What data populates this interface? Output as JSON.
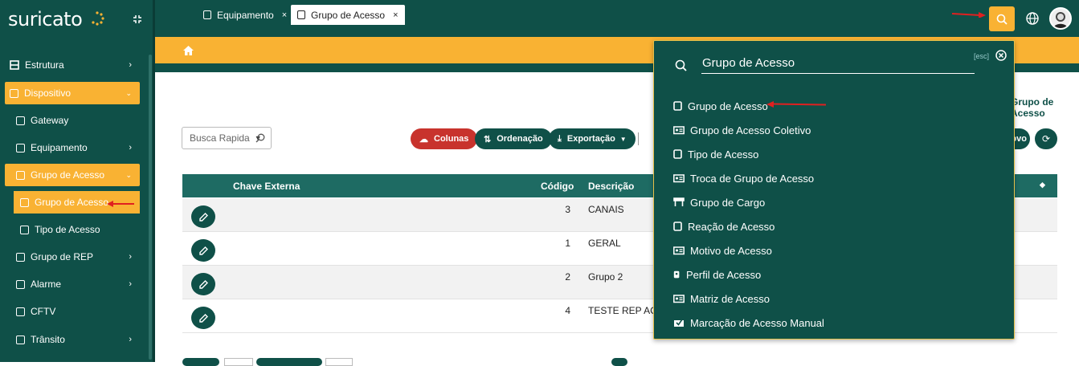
{
  "brand": {
    "logo_text": "suricato"
  },
  "sidebar": {
    "items": [
      {
        "label": "Estrutura"
      },
      {
        "label": "Dispositivo"
      },
      {
        "label": "Gateway"
      },
      {
        "label": "Equipamento"
      },
      {
        "label": "Grupo de Acesso"
      },
      {
        "label": "Grupo de Acesso"
      },
      {
        "label": "Tipo de Acesso"
      },
      {
        "label": "Grupo de REP"
      },
      {
        "label": "Alarme"
      },
      {
        "label": "CFTV"
      },
      {
        "label": "Trânsito"
      }
    ]
  },
  "tabs": [
    {
      "label": "Equipamento",
      "close": "×"
    },
    {
      "label": "Grupo de Acesso",
      "close": "×"
    }
  ],
  "breadcrumb": {
    "current": "Grupo de Acesso"
  },
  "toolbar": {
    "quick_search": "Busca Rapida",
    "colunas": "Colunas",
    "ordenacao": "Ordenação",
    "exportacao": "Exportação",
    "novo": "ovo"
  },
  "table": {
    "columns": [
      "Chave Externa",
      "Código",
      "Descrição"
    ],
    "rows": [
      {
        "codigo": "3",
        "descricao": "CANAIS"
      },
      {
        "codigo": "1",
        "descricao": "GERAL"
      },
      {
        "codigo": "2",
        "descricao": "Grupo 2"
      },
      {
        "codigo": "4",
        "descricao": "TESTE REP ACESS"
      }
    ]
  },
  "search_panel": {
    "query": "Grupo de Acesso",
    "esc": "[esc]",
    "results": [
      {
        "label": "Grupo de Acesso",
        "icon": "tablet-icon"
      },
      {
        "label": "Grupo de Acesso Coletivo",
        "icon": "id-card-icon"
      },
      {
        "label": "Tipo de Acesso",
        "icon": "tablet-icon"
      },
      {
        "label": "Troca de Grupo de Acesso",
        "icon": "id-card-icon"
      },
      {
        "label": "Grupo de Cargo",
        "icon": "building-icon"
      },
      {
        "label": "Reação de Acesso",
        "icon": "tablet-icon"
      },
      {
        "label": "Motivo de Acesso",
        "icon": "id-card-icon"
      },
      {
        "label": "Perfil de Acesso",
        "icon": "badge-icon"
      },
      {
        "label": "Matriz de Acesso",
        "icon": "id-card-icon"
      },
      {
        "label": "Marcação de Acesso Manual",
        "icon": "check-box-icon"
      }
    ]
  },
  "colors": {
    "primary": "#0f5048",
    "accent": "#f9b233",
    "danger": "#c8332d",
    "arrow": "#e02020"
  }
}
